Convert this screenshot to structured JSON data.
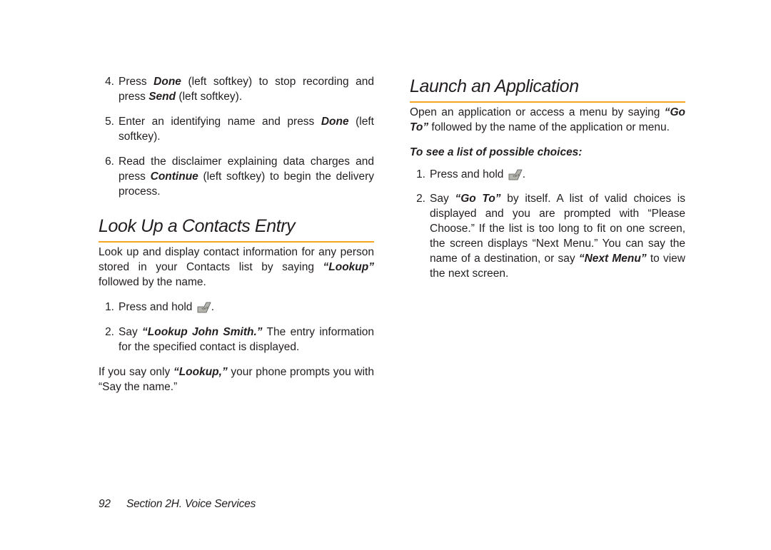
{
  "left": {
    "steps": [
      {
        "n": "4.",
        "pre": "Press ",
        "b1": "Done",
        "mid": " (left softkey) to stop recording and press ",
        "b2": "Send",
        "post": " (left softkey)."
      },
      {
        "n": "5.",
        "pre": "Enter an identifying name and press ",
        "b1": "Done",
        "post": " (left softkey)."
      },
      {
        "n": "6.",
        "pre": "Read the disclaimer explaining data charges and press ",
        "b1": "Continue",
        "post": " (left softkey) to begin the delivery process."
      }
    ],
    "heading": "Look Up a Contacts Entry",
    "intro_pre": "Look up and display contact information for any person stored in your Contacts list by saying ",
    "intro_em": "“Lookup”",
    "intro_post": " followed by the name.",
    "look_steps": [
      {
        "n": "1.",
        "txt": "Press and hold "
      },
      {
        "n": "2.",
        "pre": "Say ",
        "em": "“Lookup John Smith.”",
        "post": " The entry information for the specified contact is displayed."
      }
    ],
    "tail_pre": "If you say only ",
    "tail_em": "“Lookup,”",
    "tail_post": " your phone prompts you with “Say the name.”"
  },
  "right": {
    "heading": "Launch an Application",
    "intro_pre": "Open an application or access a menu by saying ",
    "intro_em": "“Go To”",
    "intro_post": " followed by the name of the application or menu.",
    "subhead": "To see a list of possible choices:",
    "steps": [
      {
        "n": "1.",
        "txt": "Press and hold "
      },
      {
        "n": "2.",
        "pre": "Say ",
        "em1": "“Go To”",
        "mid": " by itself. A list of valid choices is displayed and you are prompted with “Please Choose.” If the list is too long to fit on one screen, the screen displays “Next Menu.” You can say the name of a destination, or say ",
        "em2": "“Next Menu”",
        "post": " to view the next screen."
      }
    ]
  },
  "footer": {
    "page": "92",
    "section": "Section 2H. Voice Services"
  },
  "period": "."
}
